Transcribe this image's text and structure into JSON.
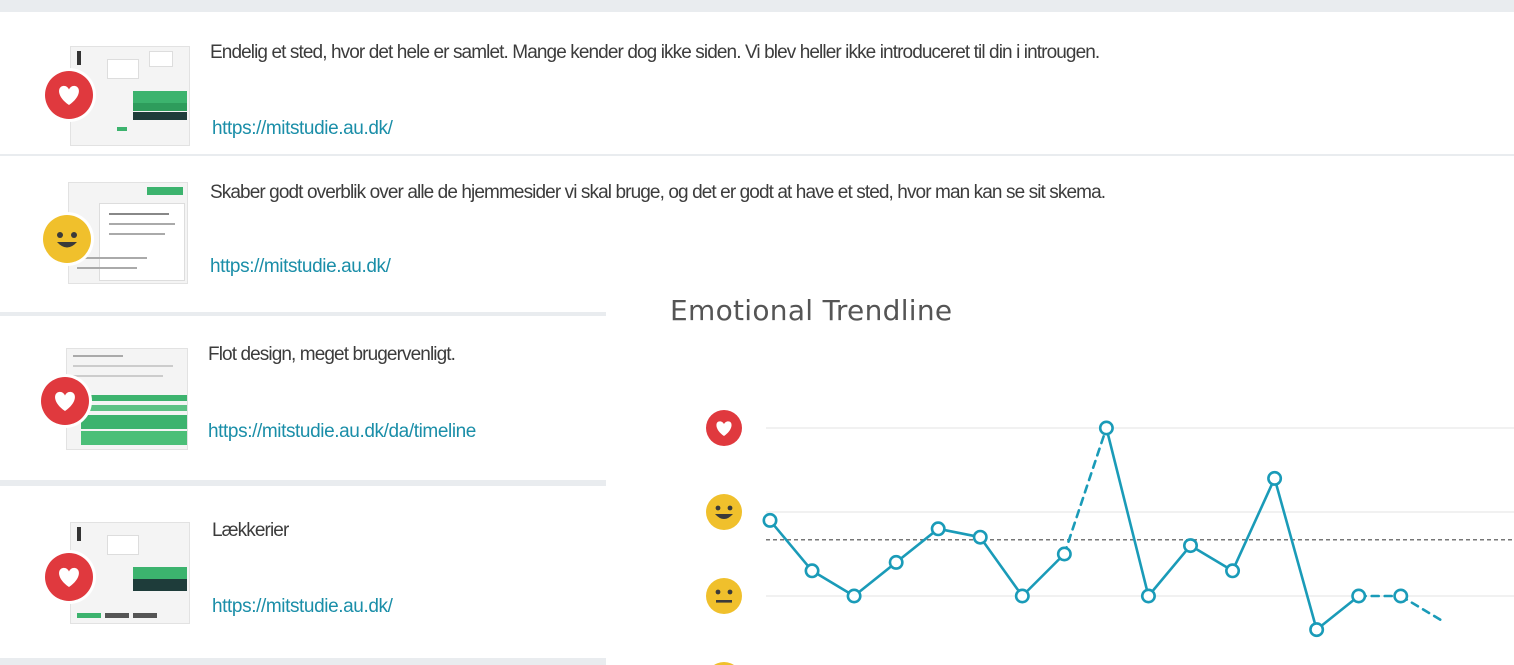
{
  "entries": [
    {
      "comment": "Endelig et sted, hvor det hele er samlet. Mange kender dog ikke siden. Vi blev heller ikke introduceret til din i introugen.",
      "url": "https://mitstudie.au.dk/",
      "emotion": "heart-icon"
    },
    {
      "comment": "Skaber godt overblik over alle de hjemmesider vi skal bruge, og det er godt at have et sted, hvor man kan se sit skema.",
      "url": "https://mitstudie.au.dk/",
      "emotion": "smiley-face-icon"
    },
    {
      "comment": "Flot design, meget brugervenligt.",
      "url": "https://mitstudie.au.dk/da/timeline",
      "emotion": "heart-icon"
    },
    {
      "comment": "Lækkerier",
      "url": "https://mitstudie.au.dk/",
      "emotion": "heart-icon"
    }
  ],
  "chart": {
    "title": "Emotional Trendline",
    "colors": {
      "line": "#1a9bb8",
      "heart": "#e0393e",
      "face": "#f0c02c",
      "grid": "#e3e3e3",
      "average": "#777777"
    }
  },
  "chart_data": {
    "type": "line",
    "y_scale": [
      "neutral",
      "happy",
      "love"
    ],
    "y_scale_icons": [
      "neutral-face-icon",
      "smiley-face-icon",
      "heart-icon"
    ],
    "ylim": [
      1,
      3
    ],
    "average": 1.67,
    "series": [
      {
        "values": [
          1.9,
          1.3,
          1.0,
          1.4,
          1.8,
          1.7,
          1.0,
          1.5,
          3.0,
          1.0,
          1.6,
          1.3,
          2.4,
          0.6,
          1.0,
          1.0,
          0.7
        ],
        "dashed_segments": [
          [
            7,
            8
          ],
          [
            14,
            15
          ],
          [
            15,
            16
          ]
        ]
      }
    ]
  }
}
